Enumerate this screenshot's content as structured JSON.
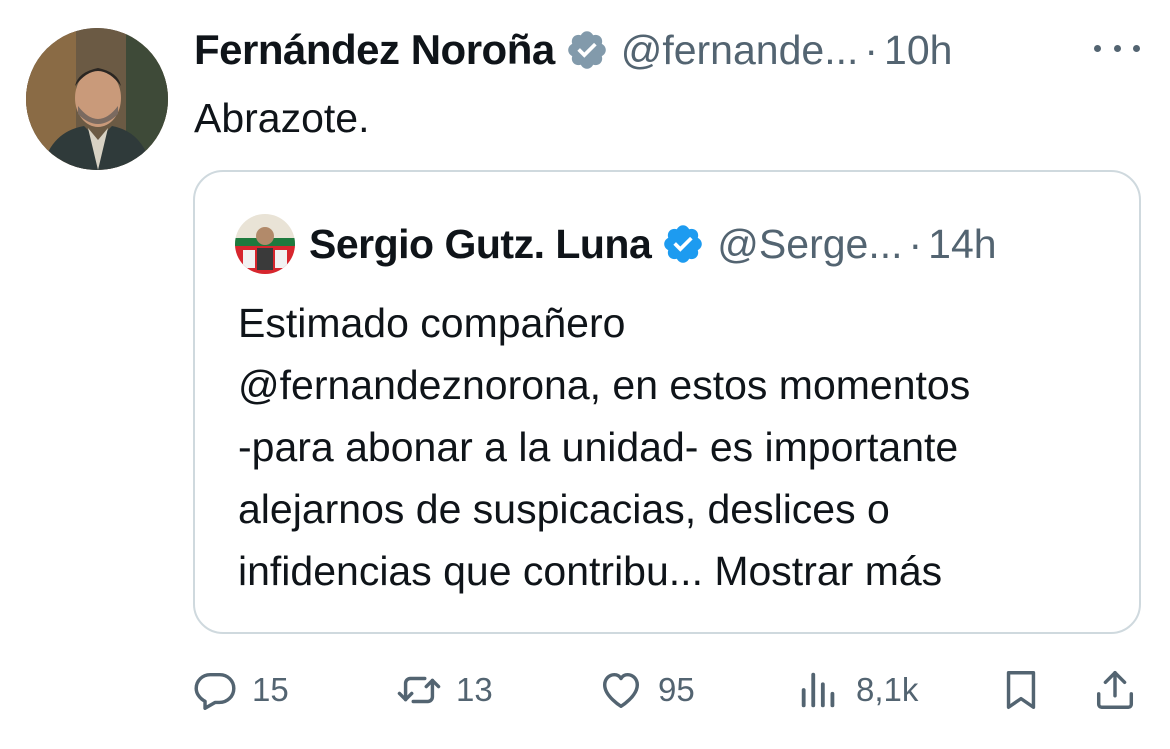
{
  "tweet": {
    "author_name": "Fernández Noroña",
    "author_handle": "@fernande...",
    "separator": "·",
    "time": "10h",
    "text": "Abrazote."
  },
  "quote": {
    "author_name": "Sergio Gutz. Luna",
    "author_handle": "@Serge...",
    "separator": "·",
    "time": "14h",
    "lines": [
      "Estimado compañero",
      "@fernandeznorona, en estos momentos",
      "-para abonar a la unidad- es importante",
      "alejarnos de suspicacias, deslices o",
      "infidencias que contribu... Mostrar más"
    ]
  },
  "actions": {
    "replies": "15",
    "reposts": "13",
    "likes": "95",
    "views": "8,1k"
  },
  "colors": {
    "text": "#0f1419",
    "secondary": "#536471",
    "border": "#cfd9de",
    "verified_blue": "#1d9bf0",
    "verified_gray": "#829aab"
  },
  "icons": {
    "verified_main": "verified-badge-gray-icon",
    "verified_quote": "verified-badge-blue-icon",
    "reply": "speech-bubble-icon",
    "repost": "repost-arrows-icon",
    "like": "heart-icon",
    "views": "bar-chart-icon",
    "bookmark": "bookmark-icon",
    "share": "share-upload-icon",
    "more": "more-dots-icon"
  }
}
